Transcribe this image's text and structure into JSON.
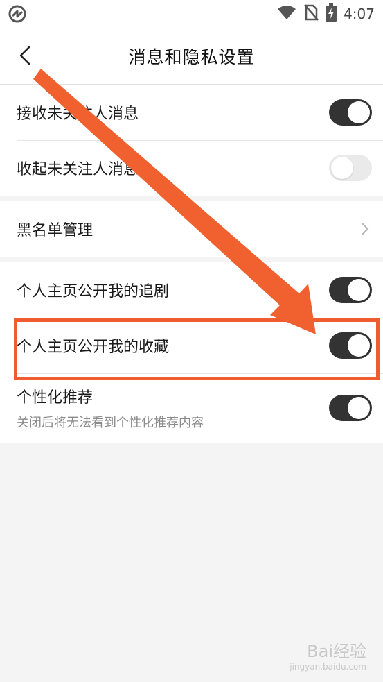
{
  "status_bar": {
    "time": "4:07",
    "icons": [
      "app-logo-icon",
      "wifi-icon",
      "no-sim-icon",
      "battery-charging-icon"
    ]
  },
  "nav": {
    "title": "消息和隐私设置",
    "back_icon": "chevron-left-icon"
  },
  "groups": [
    {
      "rows": [
        {
          "label": "接收未关注人消息",
          "control": "toggle",
          "on": true
        },
        {
          "label": "收起未关注人消息",
          "control": "toggle",
          "on": false
        }
      ]
    },
    {
      "rows": [
        {
          "label": "黑名单管理",
          "control": "chevron",
          "icon": "chevron-right-icon"
        }
      ]
    },
    {
      "rows": [
        {
          "label": "个人主页公开我的追剧",
          "control": "toggle",
          "on": true
        },
        {
          "label": "个人主页公开我的收藏",
          "control": "toggle",
          "on": true
        },
        {
          "label": "个性化推荐",
          "subtitle": "关闭后将无法看到个性化推荐内容",
          "control": "toggle",
          "on": true
        }
      ]
    }
  ],
  "annotation": {
    "arrow_color": "#f0612f",
    "highlight_color": "#ee5c2f"
  },
  "watermark": {
    "text": "Bai经验",
    "sub": "jingyan.baidu.com"
  },
  "colors": {
    "toggle_on": "#333333",
    "toggle_off": "#eaeaea",
    "background": "#f4f4f4"
  }
}
